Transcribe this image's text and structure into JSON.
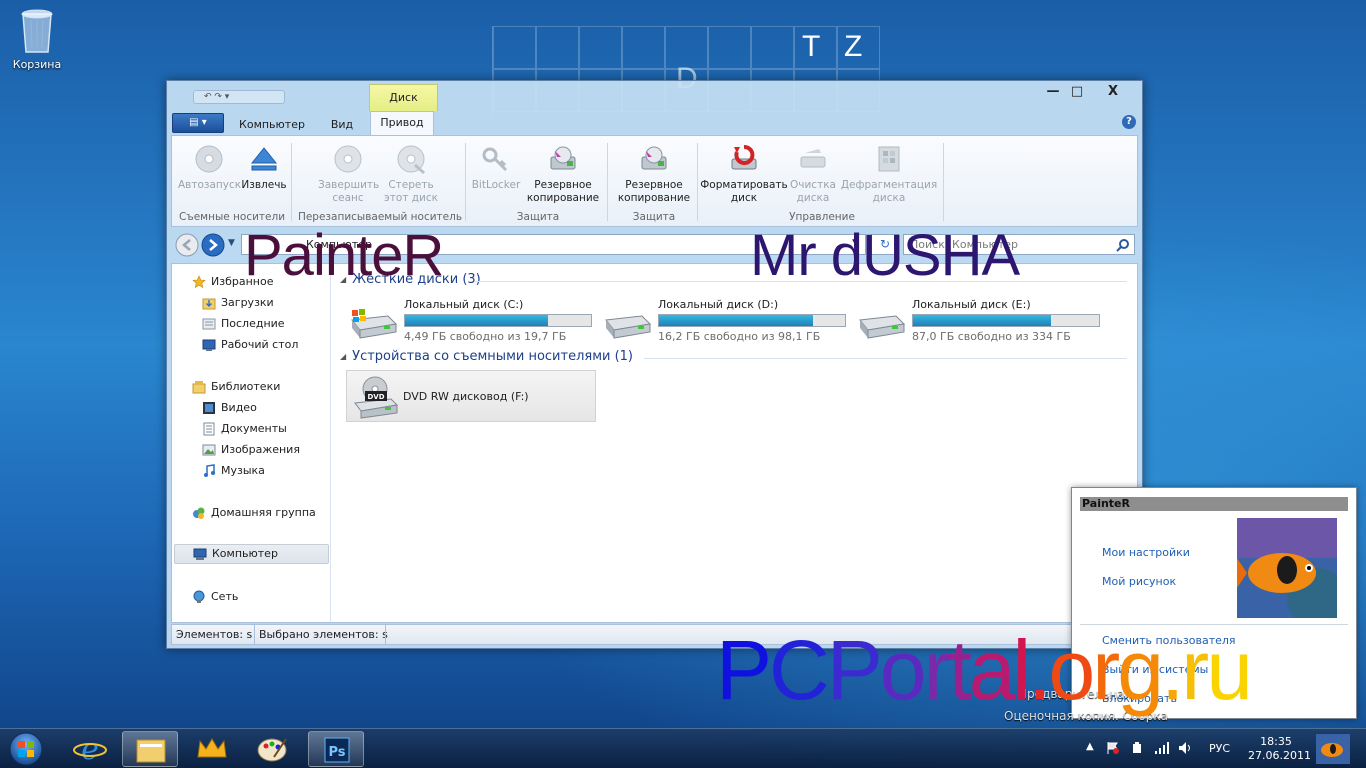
{
  "desktop": {
    "recycle_bin_label": "Корзина",
    "grid_letters": [
      "T",
      "Z",
      "D"
    ]
  },
  "window": {
    "context_tab": "Диск",
    "tabs": [
      "Компьютер",
      "Вид",
      "Привод"
    ],
    "active_tab": "Привод",
    "minimize": "—",
    "maximize": "□",
    "close": "X",
    "help": "?"
  },
  "ribbon": {
    "groups": [
      {
        "label": "Съемные носители",
        "buttons": [
          {
            "label": "Автозапуск",
            "disabled": true
          },
          {
            "label": "Извлечь",
            "disabled": false
          }
        ]
      },
      {
        "label": "Перезаписываемый носитель",
        "buttons": [
          {
            "label": "Завершить сеанс",
            "disabled": true
          },
          {
            "label": "Стереть этот диск",
            "disabled": true
          }
        ]
      },
      {
        "label": "Защита",
        "buttons": [
          {
            "label": "BitLocker",
            "disabled": true
          },
          {
            "label": "Резервное копирование",
            "disabled": false
          }
        ]
      },
      {
        "label": "Защита",
        "buttons": [
          {
            "label": "Резервное копирование",
            "disabled": false
          }
        ]
      },
      {
        "label": "Управление",
        "buttons": [
          {
            "label": "Форматировать диск",
            "disabled": false
          },
          {
            "label": "Очистка диска",
            "disabled": true
          },
          {
            "label": "Дефрагментация диска",
            "disabled": true
          }
        ]
      }
    ]
  },
  "address": {
    "path": "Компьютер",
    "search_placeholder": "Поиск: Компьютер"
  },
  "nav": {
    "favorites": "Избранное",
    "downloads": "Загрузки",
    "recent": "Последние",
    "desktop": "Рабочий стол",
    "libraries": "Библиотеки",
    "video": "Видео",
    "documents": "Документы",
    "images": "Изображения",
    "music": "Музыка",
    "homegroup": "Домашняя группа",
    "computer": "Компьютер",
    "network": "Сеть"
  },
  "content": {
    "hard_drives_header": "Жесткие диски (3)",
    "removable_header": "Устройства со съемными носителями (1)",
    "drives": [
      {
        "name": "Локальный диск (C:)",
        "free": "4,49 ГБ свободно из 19,7 ГБ",
        "used_fraction": 0.77
      },
      {
        "name": "Локальный диск (D:)",
        "free": "16,2 ГБ свободно из 98,1 ГБ",
        "used_fraction": 0.83
      },
      {
        "name": "Локальный диск (E:)",
        "free": "87,0 ГБ свободно из 334 ГБ",
        "used_fraction": 0.74
      }
    ],
    "dvd": {
      "name": "DVD RW дисковод (F:)",
      "badge": "DVD"
    }
  },
  "status": {
    "items": "Элементов: s",
    "selected": "Выбрано элементов: s"
  },
  "overlays": {
    "left_name": "PainteR",
    "right_name": "Mr dUSHA",
    "brand": "PCPortal.org.ru"
  },
  "user_card": {
    "title": "PainteR",
    "settings": "Мои настройки",
    "picture": "Мой рисунок",
    "switch_user": "Сменить пользователя",
    "logout": "Выйти из системы",
    "lock": "Блокировать"
  },
  "watermark": {
    "line1": "Предварительная",
    "line2": "Оценочная копия. Сборка"
  },
  "taskbar": {
    "language": "РУС",
    "time": "18:35",
    "date": "27.06.2011"
  }
}
